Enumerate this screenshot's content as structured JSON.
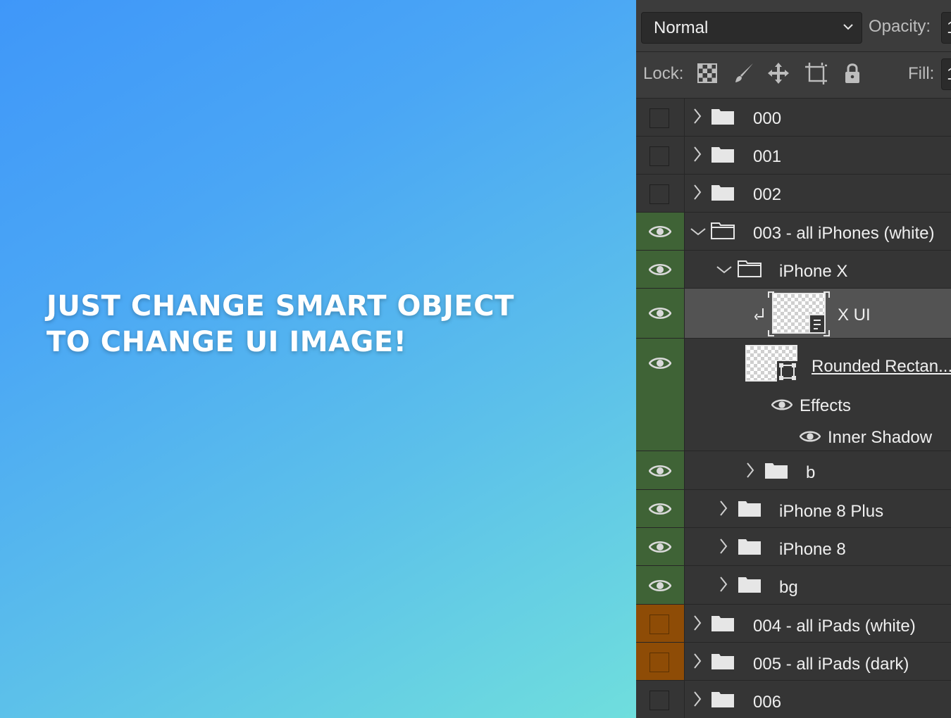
{
  "promo": {
    "line1": "JUST CHANGE SMART OBJECT",
    "line2": "TO CHANGE UI IMAGE!",
    "gradient_start": "#3f97f9",
    "gradient_end": "#6fdedd"
  },
  "panel": {
    "blend_mode": "Normal",
    "opacity_label": "Opacity:",
    "opacity_value": "1",
    "lock_label": "Lock:",
    "fill_label": "Fill:",
    "fill_value": "1",
    "lock_icons": [
      "checkerboard-icon",
      "brush-icon",
      "move-icon",
      "artboard-icon",
      "lock-icon"
    ],
    "colors": {
      "green": "#3f6336",
      "orange": "#8e4c06",
      "bg": "#323232"
    }
  },
  "layers": [
    {
      "name": "000",
      "visible": false,
      "color": "none",
      "expanded": false
    },
    {
      "name": "001",
      "visible": false,
      "color": "none",
      "expanded": false
    },
    {
      "name": "002",
      "visible": false,
      "color": "none",
      "expanded": false
    },
    {
      "name": "003 - all iPhones (white)",
      "visible": true,
      "color": "green",
      "expanded": true
    },
    {
      "name": "iPhone X",
      "visible": true,
      "color": "green",
      "expanded": true
    },
    {
      "name": "X UI",
      "visible": true,
      "color": "green",
      "type": "smart-object",
      "selected": true
    },
    {
      "name": "Rounded Rectan...",
      "visible": true,
      "color": "green",
      "type": "shape"
    },
    {
      "name": "Effects",
      "visible": true
    },
    {
      "name": "Inner Shadow",
      "visible": true
    },
    {
      "name": "b",
      "visible": true,
      "color": "green",
      "expanded": false
    },
    {
      "name": "iPhone 8 Plus",
      "visible": true,
      "color": "green",
      "expanded": false
    },
    {
      "name": "iPhone 8",
      "visible": true,
      "color": "green",
      "expanded": false
    },
    {
      "name": "bg",
      "visible": true,
      "color": "green",
      "expanded": false
    },
    {
      "name": "004 - all iPads (white)",
      "visible": false,
      "color": "orange",
      "expanded": false
    },
    {
      "name": "005 - all iPads (dark)",
      "visible": false,
      "color": "orange",
      "expanded": false
    },
    {
      "name": "006",
      "visible": false,
      "color": "none",
      "expanded": false
    }
  ]
}
